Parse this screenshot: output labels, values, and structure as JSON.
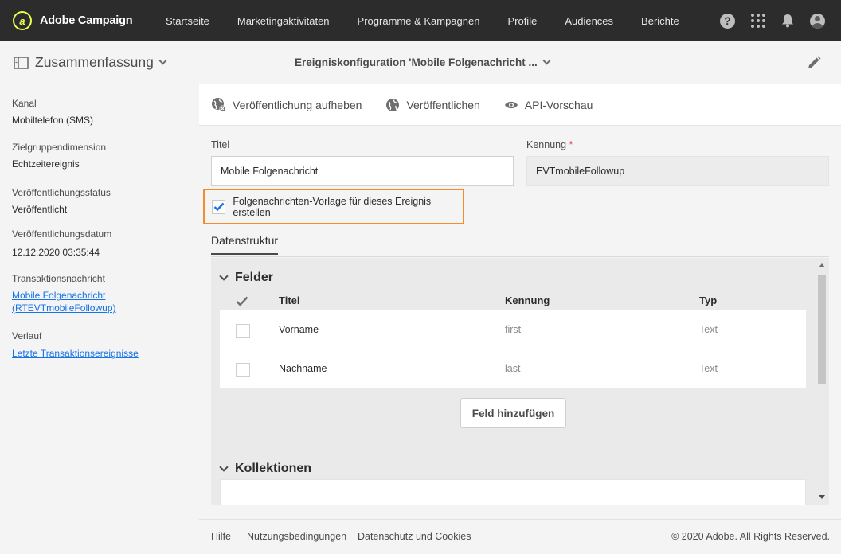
{
  "app": {
    "name": "Adobe Campaign",
    "logo_text": "a"
  },
  "nav": [
    "Startseite",
    "Marketingaktivitäten",
    "Programme & Kampagnen",
    "Profile",
    "Audiences",
    "Berichte"
  ],
  "top_icons": {
    "help": "?"
  },
  "header": {
    "summary_label": "Zusammenfassung",
    "page_title": "Ereigniskonfiguration 'Mobile Folgenachricht ..."
  },
  "sidebar": {
    "kanal_label": "Kanal",
    "kanal_value": "Mobiltelefon (SMS)",
    "dimension_label": "Zielgruppendimension",
    "dimension_value": "Echtzeitereignis",
    "status_label": "Veröffentlichungsstatus",
    "status_value": "Veröffentlicht",
    "date_label": "Veröffentlichungsdatum",
    "date_value": "12.12.2020 03:35:44",
    "tx_label": "Transaktionsnachricht",
    "tx_link_1": "Mobile Folgenachricht",
    "tx_link_2": "(RTEVTmobileFollowup)",
    "history_label": "Verlauf",
    "history_link": "Letzte Transaktionsereignisse"
  },
  "actions": {
    "unpublish": "Veröffentlichung aufheben",
    "publish": "Veröffentlichen",
    "api_preview": "API-Vorschau"
  },
  "form": {
    "title_label": "Titel",
    "title_value": "Mobile Folgenachricht",
    "id_label": "Kennung",
    "required_mark": "*",
    "id_value": "EVTmobileFollowup",
    "checkbox_label": "Folgenachrichten-Vorlage für dieses Ereignis erstellen",
    "checkbox_checked": true
  },
  "tab": {
    "label": "Datenstruktur"
  },
  "fields_section": {
    "title": "Felder",
    "columns": {
      "title": "Titel",
      "id": "Kennung",
      "type": "Typ"
    },
    "rows": [
      {
        "title": "Vorname",
        "id": "first",
        "type": "Text"
      },
      {
        "title": "Nachname",
        "id": "last",
        "type": "Text"
      }
    ],
    "add_button": "Feld hinzufügen"
  },
  "collections_section": {
    "title": "Kollektionen"
  },
  "footer": {
    "help": "Hilfe",
    "terms": "Nutzungsbedingungen",
    "privacy": "Datenschutz und Cookies",
    "copyright": "© 2020 Adobe. All Rights Reserved."
  },
  "colors": {
    "topbar": "#2c2c2c",
    "highlight_border": "#f58b2f",
    "link": "#1473e6",
    "checkmark": "#1473e6"
  }
}
